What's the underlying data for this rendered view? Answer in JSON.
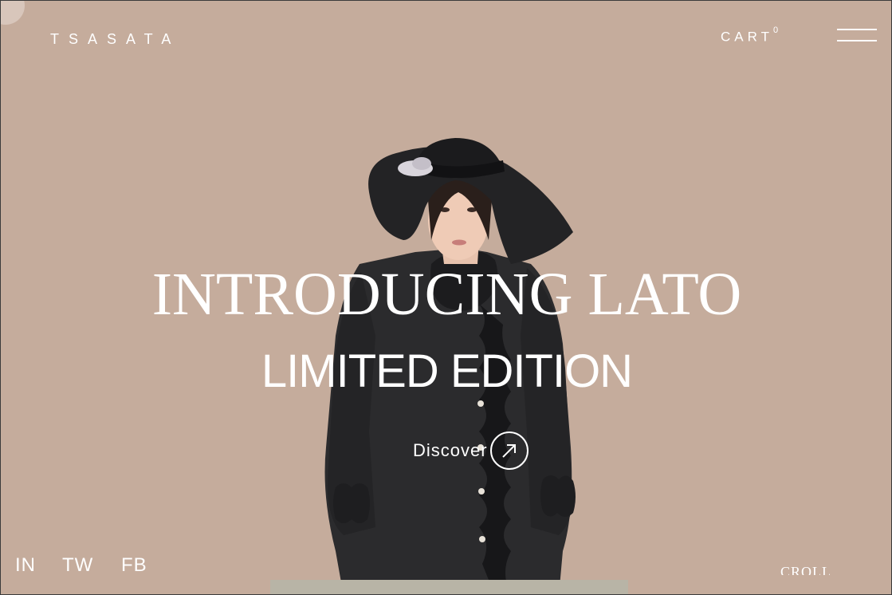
{
  "brand": {
    "logo": "TSASATA"
  },
  "header": {
    "cart_label": "CART",
    "cart_count": "0"
  },
  "hero": {
    "headline": "INTRODUCING LATO",
    "subheadline": "LIMITED EDITION",
    "cta_label": "Discover"
  },
  "social": [
    {
      "label": "IN"
    },
    {
      "label": "TW"
    },
    {
      "label": "FB"
    }
  ],
  "scroll_label": "CROLL",
  "colors": {
    "background": "#c5ac9c",
    "text": "#ffffff",
    "coat": "#2b2b2d",
    "bottom_bar": "#b8b4a6"
  }
}
